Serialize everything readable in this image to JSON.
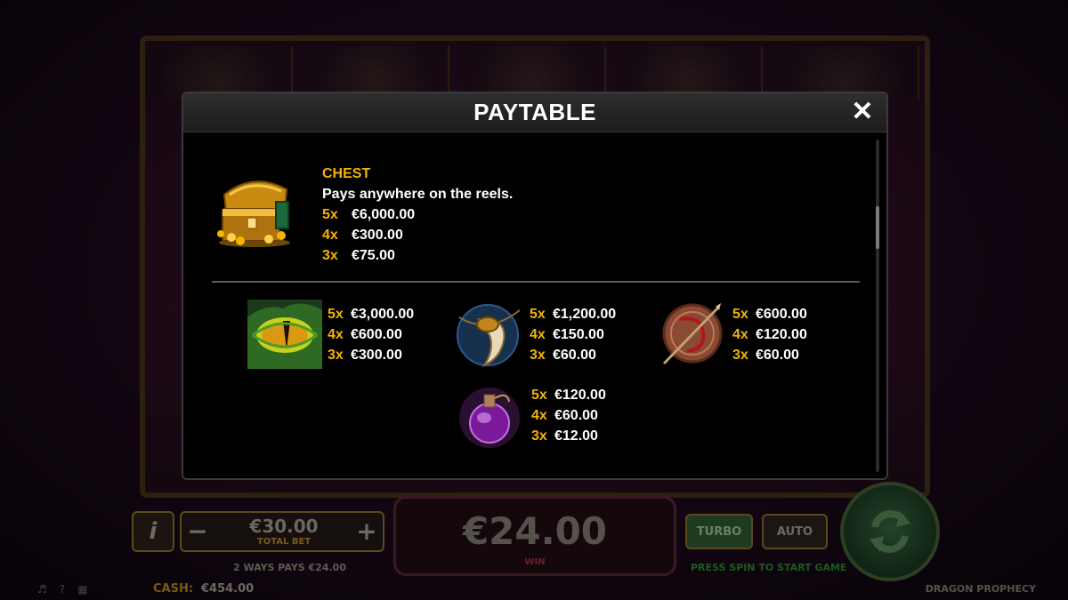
{
  "game": {
    "name": "DRAGON PROPHECY",
    "cash_label": "CASH:",
    "cash_value": "€454.00",
    "ways_text": "2 WAYS PAYS €24.00",
    "press_spin": "PRESS SPIN TO START GAME",
    "info_label": "i",
    "bet": {
      "minus": "−",
      "plus": "+",
      "value": "€30.00",
      "label": "TOTAL BET"
    },
    "win": {
      "value": "€24.00",
      "label": "WIN"
    },
    "turbo_label": "TURBO",
    "auto_label": "AUTO"
  },
  "paytable": {
    "title": "PAYTABLE",
    "close": "✕",
    "scroll_position": 0.25,
    "chest": {
      "icon": "treasure-chest",
      "name": "CHEST",
      "description": "Pays anywhere on the reels.",
      "pays": [
        {
          "mult": "5x",
          "amount": "€6,000.00"
        },
        {
          "mult": "4x",
          "amount": "€300.00"
        },
        {
          "mult": "3x",
          "amount": "€75.00"
        }
      ]
    },
    "symbols": [
      {
        "icon": "dragon-eye",
        "pays": [
          {
            "mult": "5x",
            "amount": "€3,000.00"
          },
          {
            "mult": "4x",
            "amount": "€600.00"
          },
          {
            "mult": "3x",
            "amount": "€300.00"
          }
        ]
      },
      {
        "icon": "fang-amulet",
        "pays": [
          {
            "mult": "5x",
            "amount": "€1,200.00"
          },
          {
            "mult": "4x",
            "amount": "€150.00"
          },
          {
            "mult": "3x",
            "amount": "€60.00"
          }
        ]
      },
      {
        "icon": "dragon-coin",
        "pays": [
          {
            "mult": "5x",
            "amount": "€600.00"
          },
          {
            "mult": "4x",
            "amount": "€120.00"
          },
          {
            "mult": "3x",
            "amount": "€60.00"
          }
        ]
      },
      {
        "icon": "potion",
        "pays": [
          {
            "mult": "5x",
            "amount": "€120.00"
          },
          {
            "mult": "4x",
            "amount": "€60.00"
          },
          {
            "mult": "3x",
            "amount": "€12.00"
          }
        ]
      }
    ]
  },
  "colors": {
    "accent_gold": "#f4b400",
    "modal_bg": "#000000",
    "header_bg": "#262626"
  }
}
